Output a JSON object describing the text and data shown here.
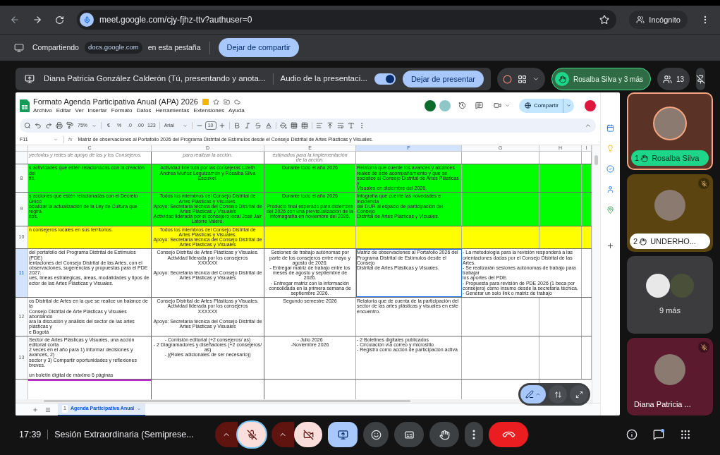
{
  "browser": {
    "url": "meet.google.com/cjy-fjhz-ttv?authuser=0",
    "profile": "Incógnito"
  },
  "share_bar": {
    "label": "Compartiendo",
    "domain": "docs.google.com",
    "suffix": "en esta pestaña",
    "button": "Dejar de compartir"
  },
  "present_bar": {
    "presenter": "Diana Patricia González Calderón (Tú, presentando y anota...",
    "audio_label": "Audio de la presentaci...",
    "audio_on": true,
    "button": "Dejar de presentar",
    "hands": "Rosalba Silva y 3 más",
    "participants": "13"
  },
  "sheet": {
    "title": "Formato Agenda Participativa Anual (APA) 2026",
    "share_button": "Compartir",
    "menu": [
      "Archivo",
      "Editar",
      "Ver",
      "Insertar",
      "Formato",
      "Datos",
      "Herramientas",
      "Extensiones",
      "Ayuda"
    ],
    "toolbar": {
      "zoom": "75%",
      "currency": "€",
      "percent": "%",
      "decrease_decimals": ".0",
      "increase_decimals": ".00",
      "number_format": "123",
      "font": "Arial",
      "font_size": "10"
    },
    "cell_ref": "F11",
    "formula_label": "fx",
    "formula": "Matriz de observaciones al Portafolio 2026 del Programa Distrital de Estímulos desde el Consejo Distrital de Artes Plásticas y Visuales.",
    "columns": [
      {
        "label": "C",
        "selected": false
      },
      {
        "label": "D",
        "selected": false
      },
      {
        "label": "E",
        "selected": false
      },
      {
        "label": "F",
        "selected": true
      },
      {
        "label": "G",
        "selected": false
      },
      {
        "label": "H",
        "selected": false
      },
      {
        "label": "I",
        "selected": false
      }
    ],
    "rows": [
      {
        "selected": false,
        "cells": {
          "C": "yectorias y redes de apoyo de las y los Consejeros.",
          "D": "para realizar la acción.",
          "E": "estimados para la implementación\nde la acción."
        }
      },
      {
        "number": "8",
        "selected": false,
        "color": "#00ff00",
        "cells": {
          "C": "s actividades que estén relacionadas con la creación del\nfiti.",
          "D": "Actividad liderada por las consejeras Lizeth\nAndrea Muñoz Leguizamón y Rosalba Silva\nEscuivel.",
          "E": "Durante todo el año 2026",
          "F": "Relatoría que cuente los avances y alcances\nreales de este acompañamiento y que se\nsocialice al Consejo Distrital de Artes Plásticas y\nVisuales en diciembre del 2026."
        }
      },
      {
        "number": "9",
        "selected": false,
        "color": "#00ff00",
        "cells": {
          "C": "s acciones que estén relacionadas con el Decreto Único\nocializar la actualización de la Ley de Cultura que regirá\nitos.",
          "D": "Todos los miembros del Consejo Distrital de\nArtes Plásticas y Visuales.\nApoyo: Secretaría técnica del Consejo Distrital de\nArtes Plásticas y Visuales\nActividad liderada por el consejero local José Jair\nLatorre Valero.",
          "E": "Durante todo el año 2026\n\nProducto final esperado para diciembre\ndel 2026 con una previsualización de la\ninfomagrafía en noviembre del 2026.",
          "F": "Infografía que cuente las novedades e incidencia\ndel DUR al espacio de participación del Consejo\nDistrital de Artes Plásticas y Visuales."
        }
      },
      {
        "number": "10",
        "selected": false,
        "color": "#ffff00",
        "cells": {
          "C": "n consejeros locales en sus territorios.",
          "D": "Todos los miembros del Consejo Distrital de\nArtes Plásticas y Visuales.\nApoyo: Secretaría técnica del Consejo Distrital de\nArtes Plásticas y Visuales"
        }
      },
      {
        "number": "11",
        "selected": true,
        "cells": {
          "C": "del portafolio del Programa Distrital de Estímulos (PDE)\nientaciones del Consejo Distrital de las Artes, con el\nobservaciones, sugerencias y propuestas para el PDE 2027.\nues, líneas estratégicas, áreas, modalidades y tipos de\nector de las Artes Plásticas y Visuales.",
          "D": "Consejo Distrital de Artes Plásticas y Visuales.\nActividad liderada por los consejeros\nXXXXXX\n\nApoyo: Secretaría técnica del Consejo Distrital de\nArtes Plásticas y Visuales",
          "E": "Sesiones de trabajo autónomas por\nparte de los consejeros entre mayo y\nagosto de 2026.\n- Entregar matriz de trabajo entre los\nmeses de agosto y septiembre de\n2026.\n- Entregar matriz con la información\nconsolidada en la primera semana de\nseptiembre 2026.",
          "F": "Matriz de observaciones al Portafolio 2026 del\nPrograma Distrital de Estímulos desde el Consejo\nDistrital de Artes Plásticas y Visuales.",
          "G": "- La metodología para la revisión responderá a las\norientaciones dadas por el Consejo Distrital de las Artes.\n- Se realizarán sesiones autónomas de trabajo para trabajar\nlos aportes del PDE.\n- Propuesta para revisión de PDE 2026 (1 beca por\nconsejero) como insumo desde la secretaría técnica.\n- Generar un solo link o matriz de trabajo"
        }
      },
      {
        "number": "12",
        "selected": false,
        "cells": {
          "C": "os Distrital de Artes en la que se realice un balance de la\nConsejo Distrital de Arte Plásticas y Visuales abordando\nara la discusión y análisis del sector de las artes plásticas y\ne Bogotá",
          "D": "Consejo Distrital de Artes Plásticas y Visuales.\nActividad liderada por los consejeros\nXXXXXX\n\nApoyo: Secretaría técnica del Consejo Distrital de\nArtes Plásticas y Visuales",
          "E": "Segundo semestre 2026",
          "F": "Relatoría que de cuenta de la participación del\nsector de las artes plásticas y visuales en este\nencuentro."
        }
      },
      {
        "number": "13",
        "selected": false,
        "cells": {
          "C": "Sector de Artes Plásticas y Visuales, una acción editorial corta\n2 veces en el año para 1) Informar decisiones y avances, 2)\nsector y 3) Compartir oportunidades y reflexiones breves.\n\nun boletín digital de máximo 6 páginas",
          "D": "- Comisión editorial (+2 consejeros/ as)\n- 2 Diagramadores y diseñadores (+2 consejeros/\nas)\n- ((Roles adicionales de ser necesario))",
          "E": "- Julio 2026\n-Noviembre 2026",
          "F": "- 2 Boletines digitales publicados\n- Circulación vía correo y micrositio\n- Registro como acción de participación activa"
        }
      }
    ],
    "sheet_tab": {
      "number": "1",
      "label": "Agenda Participativa Anual"
    }
  },
  "tiles": [
    {
      "kind": "participant",
      "name": "Rosalba Silva",
      "hand_rank": "1",
      "muted": false,
      "speaking": true,
      "color": "#5a3226"
    },
    {
      "kind": "participant",
      "name": "UNDERHO...",
      "hand_rank": "2",
      "muted": true,
      "speaking": false,
      "color": "#5b4410"
    },
    {
      "kind": "overflow",
      "name": "9 más",
      "color": "#3c3c3e"
    },
    {
      "kind": "participant",
      "name": "Diana Patricia ...",
      "muted": true,
      "speaking": false,
      "color": "#5c1a2f"
    }
  ],
  "bottom_bar": {
    "time": "17:39",
    "meeting": "Sesión Extraordinaria (Semiprese...",
    "mic_on": false,
    "camera_on": false
  }
}
